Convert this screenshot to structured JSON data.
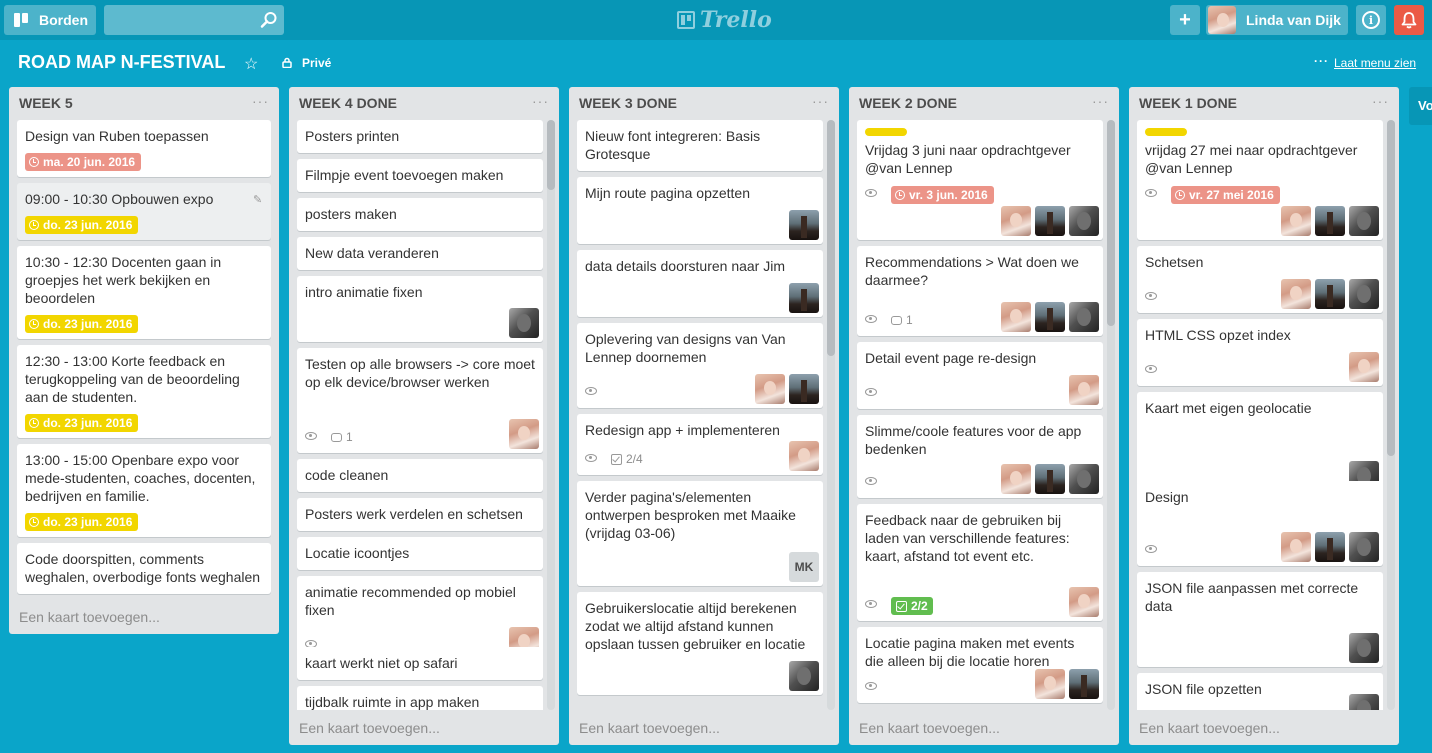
{
  "header": {
    "boards_label": "Borden",
    "search_value": "",
    "logo_text": "Trello",
    "user_name": "Linda van Dijk"
  },
  "board": {
    "title": "ROAD MAP N-FESTIVAL",
    "privacy": "Privé",
    "menu_link": "Laat menu zien",
    "partial_list_label": "Vo"
  },
  "colors": {
    "background": "#0aa5c9",
    "topbar": "#0796b6",
    "due_overdue": "#ec9488",
    "due_soon": "#f2d600",
    "label_yellow": "#f2d600",
    "checklist_done": "#61bd4f",
    "notification": "#eb5a46"
  },
  "add_card_label": "Een kaart toevoegen...",
  "lists": [
    {
      "title": "WEEK 5",
      "cards": [
        {
          "text": "Design van Ruben toepassen",
          "due": "ma. 20 jun. 2016",
          "due_color": "red"
        },
        {
          "text": "09:00 - 10:30 Opbouwen expo",
          "due": "do. 23 jun. 2016",
          "due_color": "yellow",
          "editing": true
        },
        {
          "text": "10:30 - 12:30 Docenten gaan in groepjes het werk bekijken en beoordelen",
          "due": "do. 23 jun. 2016",
          "due_color": "yellow"
        },
        {
          "text": "12:30 - 13:00 Korte feedback en terugkoppeling van de beoordeling aan de studenten.",
          "due": "do. 23 jun. 2016",
          "due_color": "yellow"
        },
        {
          "text": "13:00 - 15:00 Openbare expo voor mede-studenten, coaches, docenten, bedrijven en familie.",
          "due": "do. 23 jun. 2016",
          "due_color": "yellow"
        },
        {
          "text": "Code doorspitten, comments weghalen, overbodige fonts weghalen"
        }
      ]
    },
    {
      "title": "WEEK 4 DONE",
      "cards": [
        {
          "text": "Posters printen"
        },
        {
          "text": "Filmpje event toevoegen maken"
        },
        {
          "text": "posters maken"
        },
        {
          "text": "New data veranderen"
        },
        {
          "text": "intro animatie fixen",
          "members": [
            "bw"
          ]
        },
        {
          "text": "Testen op alle browsers -> core moet op elk device/browser werken",
          "watch": true,
          "comments": "1",
          "members": [
            "linda"
          ]
        },
        {
          "text": "code cleanen"
        },
        {
          "text": "Posters werk verdelen en schetsen"
        },
        {
          "text": "Locatie icoontjes"
        },
        {
          "text": "animatie recommended op mobiel fixen",
          "watch": true,
          "members": [
            "linda"
          ]
        },
        {
          "text": "kaart werkt niet op safari"
        },
        {
          "text": "tijdbalk ruimte in app maken"
        }
      ]
    },
    {
      "title": "WEEK 3 DONE",
      "cards": [
        {
          "text": "Nieuw font integreren: Basis Grotesque"
        },
        {
          "text": "Mijn route pagina opzetten",
          "members": [
            "city"
          ]
        },
        {
          "text": "data details doorsturen naar Jim",
          "members": [
            "city"
          ]
        },
        {
          "text": "Oplevering van designs van Van Lennep doornemen",
          "watch": true,
          "members": [
            "linda",
            "city"
          ]
        },
        {
          "text": "Redesign app + implementeren",
          "watch": true,
          "checklist": "2/4",
          "members": [
            "linda"
          ]
        },
        {
          "text": "Verder pagina's/elementen ontwerpen besproken met Maaike (vrijdag 03-06)",
          "members": [
            "mk"
          ],
          "initials": "MK"
        },
        {
          "text": "Gebruikerslocatie altijd berekenen zodat we altijd afstand kunnen opslaan tussen gebruiker en locatie",
          "members": [
            "bw"
          ]
        }
      ]
    },
    {
      "title": "WEEK 2 DONE",
      "cards": [
        {
          "text": "Vrijdag 3 juni naar opdrachtgever @van Lennep",
          "label": true,
          "watch": true,
          "due": "vr. 3 jun. 2016",
          "due_color": "red",
          "members": [
            "linda",
            "city",
            "bw"
          ]
        },
        {
          "text": "Recommendations > Wat doen we daarmee?",
          "watch": true,
          "comments": "1",
          "members": [
            "linda",
            "city",
            "bw"
          ]
        },
        {
          "text": "Detail event page re-design",
          "watch": true,
          "members": [
            "linda"
          ]
        },
        {
          "text": "Slimme/coole features voor de app bedenken",
          "watch": true,
          "members": [
            "linda",
            "city",
            "bw"
          ]
        },
        {
          "text": "Feedback naar de gebruiken bij laden van verschillende features: kaart, afstand tot event etc.",
          "watch": true,
          "checklist_done": "2/2",
          "members": [
            "linda"
          ]
        },
        {
          "text": "Locatie pagina maken met events die alleen bij die locatie horen",
          "watch": true,
          "members": [
            "linda",
            "city"
          ]
        }
      ]
    },
    {
      "title": "WEEK 1 DONE",
      "cards": [
        {
          "text": "vrijdag 27 mei naar opdrachtgever @van Lennep",
          "label": true,
          "watch": true,
          "due": "vr. 27 mei 2016",
          "due_color": "red",
          "members": [
            "linda",
            "city",
            "bw"
          ]
        },
        {
          "text": "Schetsen",
          "watch": true,
          "members": [
            "linda",
            "city",
            "bw"
          ]
        },
        {
          "text": "HTML CSS opzet index",
          "watch": true,
          "members": [
            "linda"
          ]
        },
        {
          "text": "Kaart met eigen geolocatie",
          "members": [
            "bw"
          ]
        },
        {
          "text": "Design",
          "watch": true,
          "members": [
            "linda",
            "city",
            "bw"
          ]
        },
        {
          "text": "JSON file aanpassen met correcte data",
          "members": [
            "bw"
          ]
        },
        {
          "text": "JSON file opzetten",
          "members": [
            "bw"
          ]
        }
      ]
    }
  ]
}
